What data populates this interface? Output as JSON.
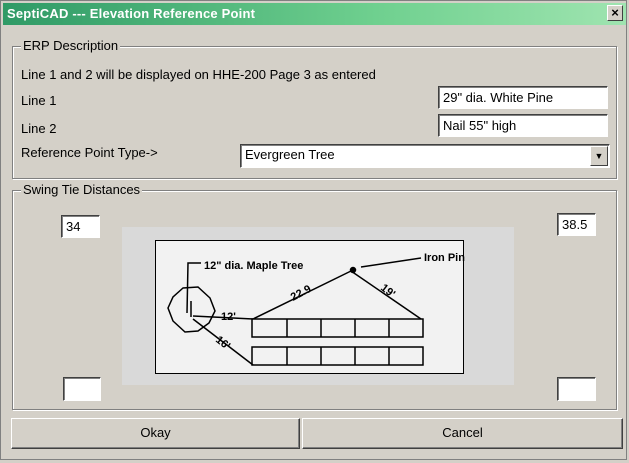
{
  "window": {
    "title": "SeptiCAD --- Elevation Reference Point",
    "close_label": "×"
  },
  "erp": {
    "legend": "ERP Description",
    "info": "Line 1 and 2 will be displayed on HHE-200 Page 3 as entered",
    "line1_label": "Line 1",
    "line1_value": "29\" dia. White Pine",
    "line2_label": "Line 2",
    "line2_value": "Nail 55\" high",
    "type_label": "Reference Point Type->",
    "type_value": "Evergreen Tree"
  },
  "swing": {
    "legend": "Swing Tie Distances",
    "top_left": "34",
    "top_right": "38.5",
    "bottom_left": "",
    "bottom_right": ""
  },
  "diagram": {
    "maple_label": "12\" dia. Maple Tree",
    "iron_label": "Iron Pin",
    "dist_22_9": "22.9",
    "dist_19": "19'",
    "dist_12": "12'",
    "dist_16": "16'"
  },
  "buttons": {
    "okay": "Okay",
    "cancel": "Cancel"
  }
}
